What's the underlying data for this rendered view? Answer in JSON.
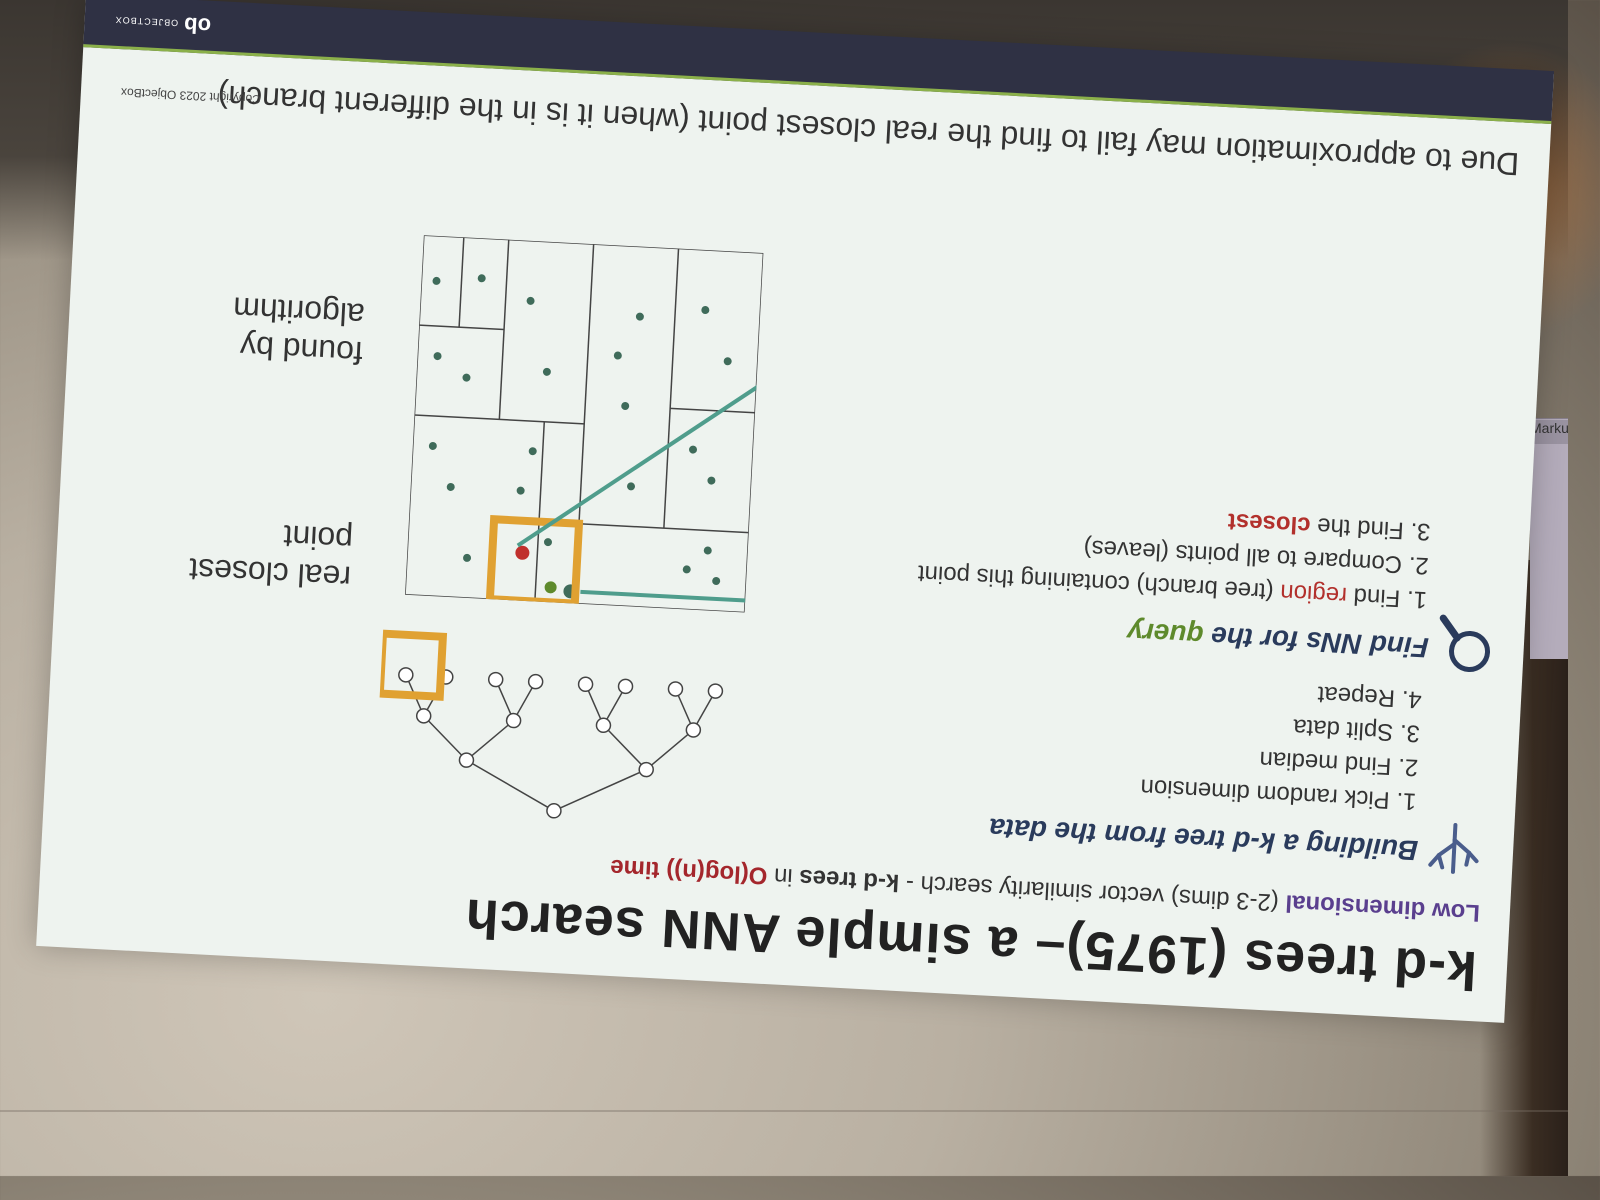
{
  "slide": {
    "title": "k-d trees (1975)– a simple ANN search",
    "subtitle": {
      "part1": "Low dimensional",
      "part2": " (2-3 dims) vector similarity search - ",
      "part3": "k-d trees",
      "part4": " in ",
      "part5": "O(log(n)) time"
    },
    "build_section": {
      "heading": "Building a k-d tree from the data",
      "steps": [
        "Pick random dimension",
        "Find median",
        "Split data",
        "Repeat"
      ]
    },
    "find_section": {
      "heading_a": "Find NNs for the ",
      "heading_b": "query",
      "step1_a": "Find ",
      "step1_b": "region",
      "step1_c": " (tree branch) containing this point",
      "step2": "Compare to all points (leaves)",
      "step3_a": "Find the ",
      "step3_b": "closest"
    },
    "label_real": "real closest\npoint",
    "label_found": "found by\nalgorithm",
    "note": "Due to approximation may fail to find the real closest point (when it is in the different branch)",
    "copyright": "Copyright 2023 ObjectBox",
    "logo_mark": "ob",
    "logo_text": "OBJECTBOX",
    "side_label": "Marku",
    "colors": {
      "footer": "#2f3144",
      "accent_green": "#5e8a2c",
      "accent_red": "#b2302c",
      "box_orange": "#e0a132",
      "arrow_teal": "#4f9d8c"
    }
  }
}
